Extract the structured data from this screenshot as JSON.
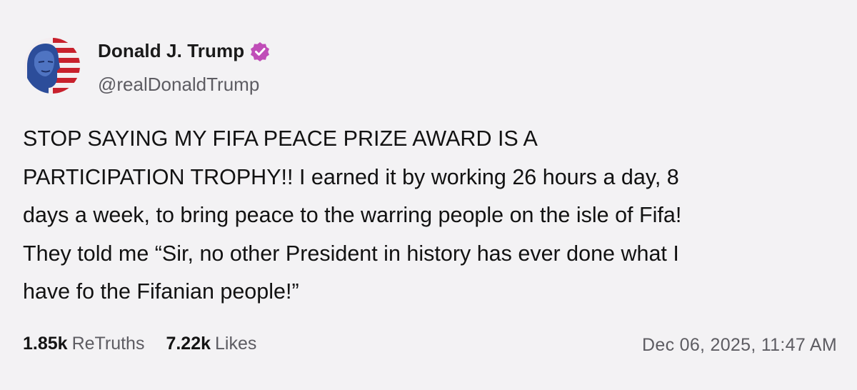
{
  "author": {
    "display_name": "Donald J. Trump",
    "handle": "@realDonaldTrump",
    "verified": true,
    "verified_badge_color": "#c04db8"
  },
  "post": {
    "lines": [
      "STOP SAYING MY FIFA PEACE PRIZE AWARD IS A",
      "PARTICIPATION TROPHY!! I earned it by working 26 hours a day, 8",
      "days a week, to bring peace to the warring people on the isle of Fifa!",
      "They told me “Sir, no other President in history has ever done what I",
      "have fo the Fifanian people!”"
    ]
  },
  "stats": {
    "retruths_count": "1.85k",
    "retruths_label": "ReTruths",
    "likes_count": "7.22k",
    "likes_label": "Likes"
  },
  "timestamp": "Dec 06, 2025, 11:47 AM",
  "icons": {
    "avatar": "profile-photo-flag",
    "badge": "verified-badge-icon"
  }
}
